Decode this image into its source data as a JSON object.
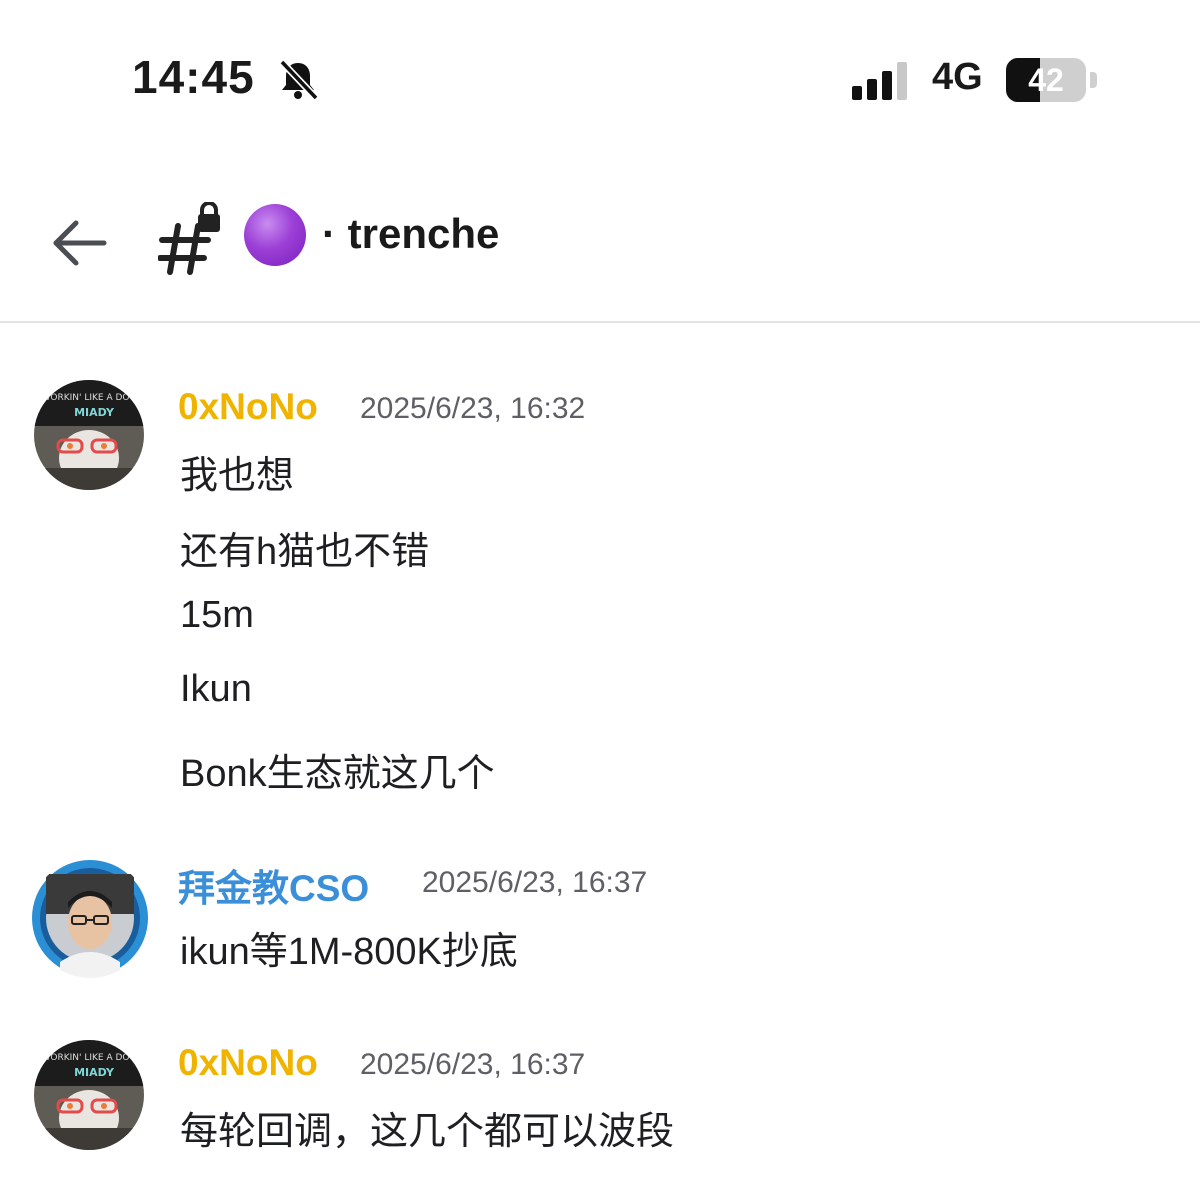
{
  "status_bar": {
    "time": "14:45",
    "network": "4G",
    "battery_level": "42",
    "battery_fraction": 0.42,
    "icons": [
      "bell-slash-icon",
      "signal-icon",
      "battery-icon"
    ]
  },
  "header": {
    "channel_name": "· trenche",
    "icons": [
      "back-arrow-icon",
      "locked-channel-icon",
      "purple-circle-emoji"
    ]
  },
  "colors": {
    "oxnono": "#f0b400",
    "cso": "#3b8fd9",
    "timestamp": "#5e6066",
    "emoji": "#9b3fd6"
  },
  "messages": [
    {
      "author": "0xNoNo",
      "timestamp": "2025/6/23, 16:32",
      "lines": [
        "我也想",
        "还有h猫也不错",
        "15m",
        "Ikun",
        "Bonk生态就这几个"
      ]
    },
    {
      "author": "拜金教CSO",
      "timestamp": "2025/6/23, 16:37",
      "lines": [
        "ikun等1M-800K抄底"
      ]
    },
    {
      "author": "0xNoNo",
      "timestamp": "2025/6/23, 16:37",
      "lines": [
        "每轮回调，这几个都可以波段"
      ]
    }
  ]
}
